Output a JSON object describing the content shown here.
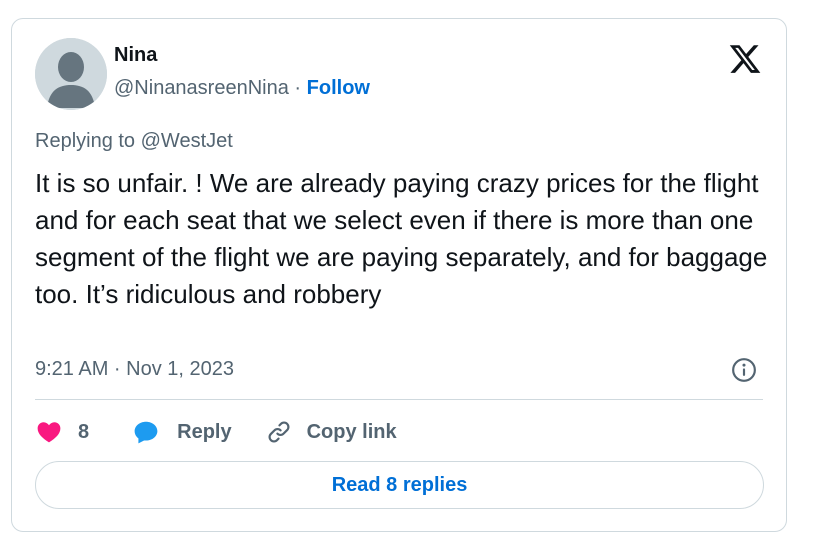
{
  "author": {
    "name": "Nina",
    "handle": "@NinanasreenNina",
    "separator": "·",
    "follow_label": "Follow"
  },
  "reply_context": {
    "prefix": "Replying to",
    "mention": "@WestJet"
  },
  "tweet": {
    "text": "It is so unfair. ! We are already paying crazy prices for the flight and for each seat that we select even if there is more than one segment of the flight we are paying separately, and for baggage too. It’s ridiculous and robbery",
    "time": "9:21 AM · Nov 1, 2023"
  },
  "actions": {
    "like_count": "8",
    "reply_label": "Reply",
    "copy_label": "Copy link"
  },
  "read_replies_label": "Read 8 replies",
  "colors": {
    "like": "#f91880",
    "reply": "#1d9bf0",
    "link": "#006fd6",
    "muted": "#536471",
    "border": "#cfd9de"
  },
  "icons": [
    "x-logo-icon",
    "info-icon",
    "heart-icon",
    "reply-bubble-icon",
    "link-icon",
    "avatar-placeholder-icon"
  ]
}
